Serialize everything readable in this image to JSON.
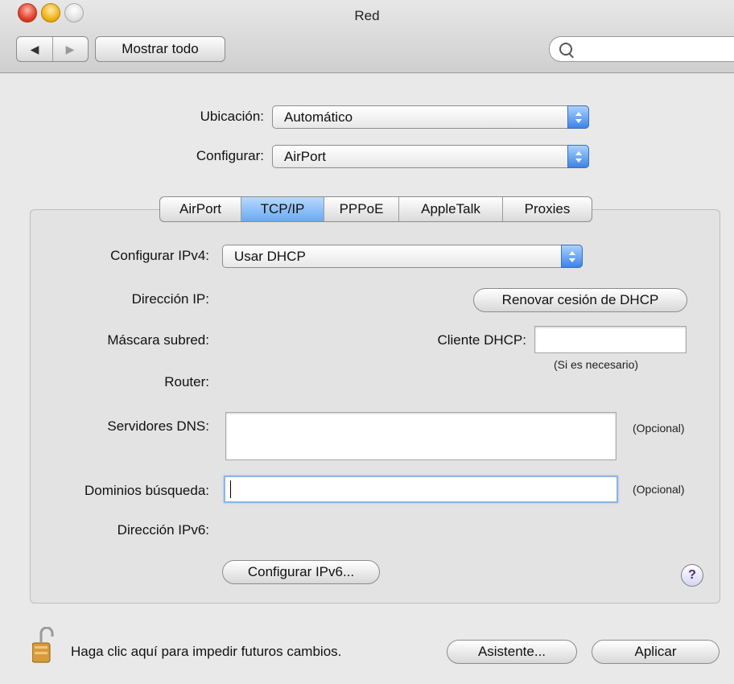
{
  "window": {
    "title": "Red"
  },
  "toolbar": {
    "back_glyph": "◀",
    "forward_glyph": "▶",
    "show_all": "Mostrar todo",
    "search_placeholder": ""
  },
  "location": {
    "label": "Ubicación:",
    "value": "Automático"
  },
  "configure": {
    "label": "Configurar:",
    "value": "AirPort"
  },
  "tabs": [
    {
      "label": "AirPort",
      "selected": false
    },
    {
      "label": "TCP/IP",
      "selected": true
    },
    {
      "label": "PPPoE",
      "selected": false
    },
    {
      "label": "AppleTalk",
      "selected": false
    },
    {
      "label": "Proxies",
      "selected": false
    }
  ],
  "tcpip": {
    "ipv4": {
      "label": "Configurar IPv4:",
      "value": "Usar DHCP"
    },
    "ip_address_label": "Dirección IP:",
    "renew_button": "Renovar cesión de DHCP",
    "subnet_label": "Máscara subred:",
    "dhcp_client_label": "Cliente DHCP:",
    "dhcp_client_value": "",
    "if_needed": "(Si es necesario)",
    "router_label": "Router:",
    "dns_label": "Servidores DNS:",
    "dns_value": "",
    "optional": "(Opcional)",
    "search_domains_label": "Dominios búsqueda:",
    "search_domains_value": "",
    "ipv6_address_label": "Dirección IPv6:",
    "configure_ipv6_button": "Configurar IPv6..."
  },
  "help": {
    "glyph": "?"
  },
  "footer": {
    "lock_text": "Haga clic aquí para impedir futuros cambios.",
    "assistant_button": "Asistente...",
    "apply_button": "Aplicar"
  },
  "colors": {
    "accent": "#5aa0f0",
    "window_bg": "#e9e9e9"
  },
  "icons": [
    "search-icon",
    "lock-icon",
    "help-icon",
    "back-arrow-icon",
    "forward-arrow-icon"
  ]
}
